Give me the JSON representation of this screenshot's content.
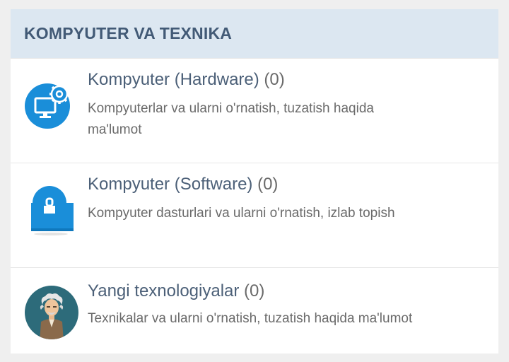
{
  "section": {
    "title": "KOMPYUTER VA TEXNIKA"
  },
  "categories": [
    {
      "icon": "computer-settings-icon",
      "name": "Kompyuter (Hardware)",
      "count": "(0)",
      "description": "Kompyuterlar va ularni o'rnatish, tuzatish haqida ma'lumot"
    },
    {
      "icon": "software-box-icon",
      "name": "Kompyuter (Software)",
      "count": "(0)",
      "description": "Kompyuter dasturlari va ularni o'rnatish, izlab topish"
    },
    {
      "icon": "scientist-avatar-icon",
      "name": "Yangi texnologiyalar",
      "count": "(0)",
      "description": "Texnikalar va ularni o'rnatish, tuzatish haqida ma'lumot"
    }
  ],
  "colors": {
    "header_bg": "#dce7f1",
    "header_text": "#425a76",
    "accent_blue": "#1a8ed9",
    "title_text": "#4c6078",
    "desc_text": "#6a6a6a"
  }
}
